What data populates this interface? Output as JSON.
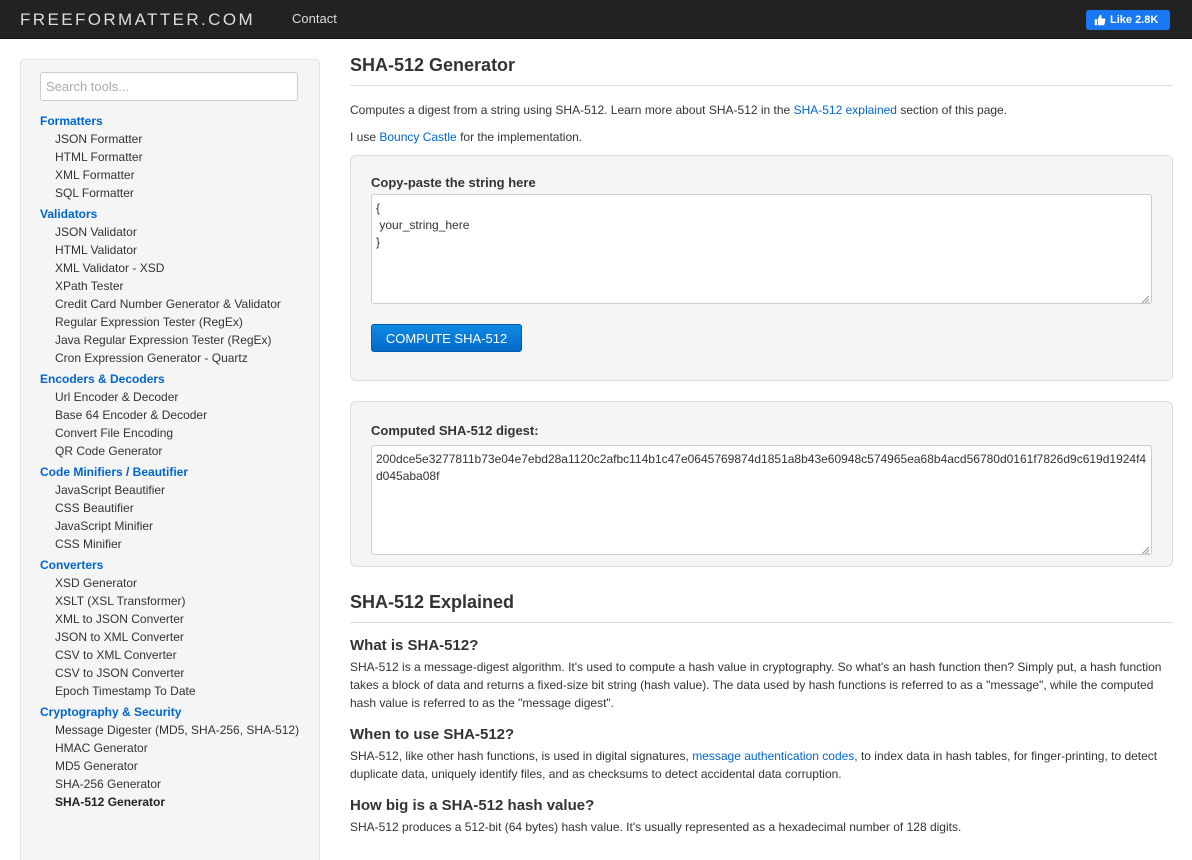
{
  "header": {
    "brand": "FREEFORMATTER.COM",
    "contact": "Contact",
    "like_label": "Like 2.8K",
    "like_icon": "thumbs-up-icon",
    "like_color": "#1877f2"
  },
  "search": {
    "placeholder": "Search tools..."
  },
  "sidebar": {
    "groups": [
      {
        "title": "Formatters",
        "items": [
          "JSON Formatter",
          "HTML Formatter",
          "XML Formatter",
          "SQL Formatter"
        ]
      },
      {
        "title": "Validators",
        "items": [
          "JSON Validator",
          "HTML Validator",
          "XML Validator - XSD",
          "XPath Tester",
          "Credit Card Number Generator & Validator",
          "Regular Expression Tester (RegEx)",
          "Java Regular Expression Tester (RegEx)",
          "Cron Expression Generator - Quartz"
        ]
      },
      {
        "title": "Encoders & Decoders",
        "items": [
          "Url Encoder & Decoder",
          "Base 64 Encoder & Decoder",
          "Convert File Encoding",
          "QR Code Generator"
        ]
      },
      {
        "title": "Code Minifiers / Beautifier",
        "items": [
          "JavaScript Beautifier",
          "CSS Beautifier",
          "JavaScript Minifier",
          "CSS Minifier"
        ]
      },
      {
        "title": "Converters",
        "items": [
          "XSD Generator",
          "XSLT (XSL Transformer)",
          "XML to JSON Converter",
          "JSON to XML Converter",
          "CSV to XML Converter",
          "CSV to JSON Converter",
          "Epoch Timestamp To Date"
        ]
      },
      {
        "title": "Cryptography & Security",
        "items": [
          "Message Digester (MD5, SHA-256, SHA-512)",
          "HMAC Generator",
          "MD5 Generator",
          "SHA-256 Generator",
          "SHA-512 Generator"
        ]
      }
    ],
    "active_item": "SHA-512 Generator"
  },
  "main": {
    "title": "SHA-512 Generator",
    "intro_prefix": "Computes a digest from a string using SHA-512. Learn more about SHA-512 in the ",
    "intro_link": "SHA-512 explained",
    "intro_suffix": " section of this page.",
    "impl_prefix": "I use ",
    "impl_link": "Bouncy Castle",
    "impl_suffix": " for the implementation.",
    "input_label": "Copy-paste the string here",
    "input_value": "{\n your_string_here\n}",
    "compute_button": "COMPUTE SHA-512",
    "output_label": "Computed SHA-512 digest:",
    "output_value": "200dce5e3277811b73e04e7ebd28a1120c2afbc114b1c47e0645769874d1851a8b43e60948c574965ea68b4acd56780d0161f7826d9c619d1924f4d045aba08f",
    "explained_title": "SHA-512 Explained",
    "q1_title": "What is SHA-512?",
    "q1_text": "SHA-512 is a message-digest algorithm. It's used to compute a hash value in cryptography. So what's an hash function then? Simply put, a hash function takes a block of data and returns a fixed-size bit string (hash value). The data used by hash functions is referred to as a \"message\", while the computed hash value is referred to as the \"message digest\".",
    "q2_title": "When to use SHA-512?",
    "q2_prefix": "SHA-512, like other hash functions, is used in digital signatures, ",
    "q2_link": "message authentication codes",
    "q2_suffix": ", to index data in hash tables, for finger-printing, to detect duplicate data, uniquely identify files, and as checksums to detect accidental data corruption.",
    "q3_title": "How big is a SHA-512 hash value?",
    "q3_text": "SHA-512 produces a 512-bit (64 bytes) hash value. It's usually represented as a hexadecimal number of 128 digits."
  },
  "colors": {
    "link": "#0066cc",
    "button": "#0a7bd6",
    "navbar": "#222222"
  }
}
